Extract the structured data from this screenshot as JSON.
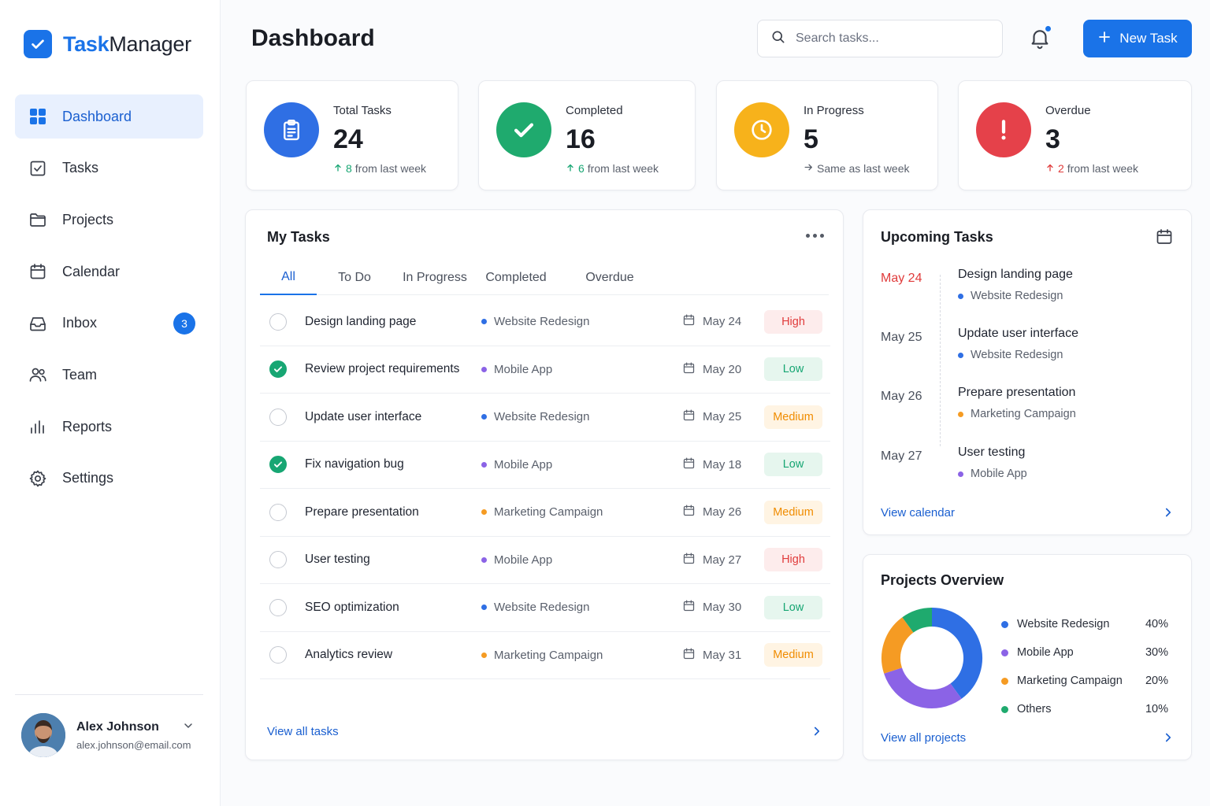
{
  "app": {
    "name_part1": "Task",
    "name_part2": "Manager"
  },
  "sidebar": {
    "items": [
      {
        "label": "Dashboard",
        "icon": "grid-icon"
      },
      {
        "label": "Tasks",
        "icon": "checkbox-icon"
      },
      {
        "label": "Projects",
        "icon": "folder-icon"
      },
      {
        "label": "Calendar",
        "icon": "calendar-icon"
      },
      {
        "label": "Inbox",
        "icon": "inbox-icon",
        "badge": "3"
      },
      {
        "label": "Team",
        "icon": "users-icon"
      },
      {
        "label": "Reports",
        "icon": "bar-chart-icon"
      },
      {
        "label": "Settings",
        "icon": "gear-icon"
      }
    ],
    "active": "Dashboard"
  },
  "user": {
    "name": "Alex Johnson",
    "email": "alex.johnson@email.com"
  },
  "header": {
    "title": "Dashboard",
    "search_placeholder": "Search tasks...",
    "new_task_label": "New Task"
  },
  "stats": [
    {
      "label": "Total Tasks",
      "value": "24",
      "change_value": "8",
      "change_text": "from last week",
      "trend": "up-green",
      "color": "#2f6fe4",
      "icon": "clipboard-icon"
    },
    {
      "label": "Completed",
      "value": "16",
      "change_value": "6",
      "change_text": "from last week",
      "trend": "up-green",
      "color": "#1faa6e",
      "icon": "check-icon"
    },
    {
      "label": "In Progress",
      "value": "5",
      "change_value": "",
      "change_text": "Same as last week",
      "trend": "flat",
      "color": "#f7b21b",
      "icon": "clock-icon"
    },
    {
      "label": "Overdue",
      "value": "3",
      "change_value": "2",
      "change_text": "from last week",
      "trend": "up-red",
      "color": "#e5414a",
      "icon": "exclamation-icon"
    }
  ],
  "my_tasks": {
    "title": "My Tasks",
    "tabs": [
      "All",
      "To Do",
      "In Progress",
      "Completed",
      "Overdue"
    ],
    "active_tab": "All",
    "rows": [
      {
        "name": "Design landing page",
        "project": "Website Redesign",
        "date": "May 24",
        "priority": "High",
        "done": false
      },
      {
        "name": "Review project requirements",
        "project": "Mobile App",
        "date": "May 20",
        "priority": "Low",
        "done": true
      },
      {
        "name": "Update user interface",
        "project": "Website Redesign",
        "date": "May 25",
        "priority": "Medium",
        "done": false
      },
      {
        "name": "Fix navigation bug",
        "project": "Mobile App",
        "date": "May 18",
        "priority": "Low",
        "done": true
      },
      {
        "name": "Prepare presentation",
        "project": "Marketing Campaign",
        "date": "May 26",
        "priority": "Medium",
        "done": false
      },
      {
        "name": "User testing",
        "project": "Mobile App",
        "date": "May 27",
        "priority": "High",
        "done": false
      },
      {
        "name": "SEO optimization",
        "project": "Website Redesign",
        "date": "May 30",
        "priority": "Low",
        "done": false
      },
      {
        "name": "Analytics review",
        "project": "Marketing Campaign",
        "date": "May 31",
        "priority": "Medium",
        "done": false
      }
    ],
    "view_all": "View all tasks"
  },
  "upcoming": {
    "title": "Upcoming Tasks",
    "items": [
      {
        "date": "May 24",
        "title": "Design landing page",
        "project": "Website Redesign",
        "highlight": true
      },
      {
        "date": "May 25",
        "title": "Update user interface",
        "project": "Website Redesign",
        "highlight": false
      },
      {
        "date": "May 26",
        "title": "Prepare presentation",
        "project": "Marketing Campaign",
        "highlight": false
      },
      {
        "date": "May 27",
        "title": "User testing",
        "project": "Mobile App",
        "highlight": false
      }
    ],
    "view_link": "View calendar"
  },
  "projects": {
    "title": "Projects Overview",
    "breakdown": [
      {
        "name": "Website Redesign",
        "pct": "40%",
        "value": 40
      },
      {
        "name": "Mobile App",
        "pct": "30%",
        "value": 30
      },
      {
        "name": "Marketing Campaign",
        "pct": "20%",
        "value": 20
      },
      {
        "name": "Others",
        "pct": "10%",
        "value": 10
      }
    ],
    "view_link": "View all projects"
  },
  "colors": {
    "accent": "#1a73e8",
    "project": {
      "Website Redesign": "#2f6fe4",
      "Mobile App": "#8b63e6",
      "Marketing Campaign": "#f59b23",
      "Others": "#1faa6e"
    },
    "priority": {
      "High": {
        "bg": "#fdecec",
        "fg": "#e03b3b"
      },
      "Medium": {
        "bg": "#fff4e3",
        "fg": "#f08c00"
      },
      "Low": {
        "bg": "#e6f6ee",
        "fg": "#17a673"
      }
    }
  }
}
